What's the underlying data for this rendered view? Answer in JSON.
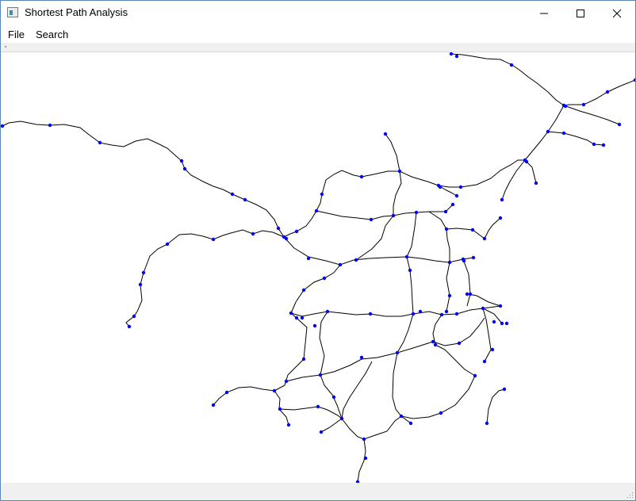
{
  "window": {
    "title": "Shortest Path Analysis"
  },
  "menu": {
    "items": [
      "File",
      "Search"
    ]
  },
  "icons": {
    "app": "app-window-icon",
    "minimize": "minimize-icon",
    "maximize": "maximize-icon",
    "close": "close-icon",
    "resize": "resize-grip-icon"
  },
  "map": {
    "line_color": "#000000",
    "node_color": "#0000ff"
  }
}
